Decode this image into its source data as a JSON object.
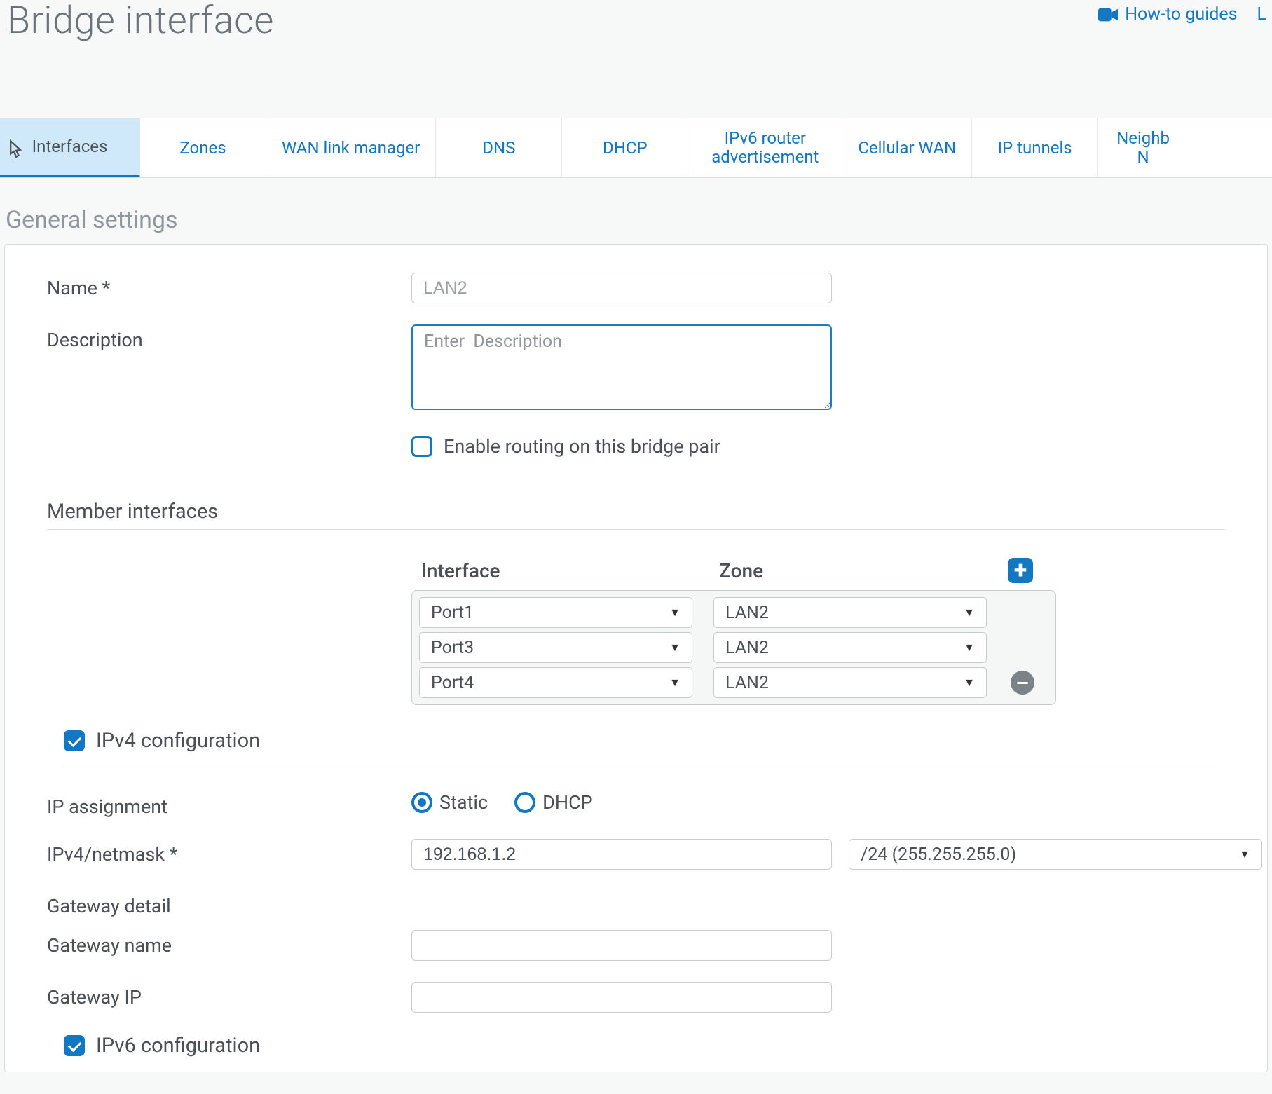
{
  "header": {
    "title": "Bridge interface",
    "howto_link": "How-to guides",
    "extra_link": "L"
  },
  "tabs": {
    "items": [
      {
        "label": "Interfaces",
        "active": true
      },
      {
        "label": "Zones"
      },
      {
        "label": "WAN link manager"
      },
      {
        "label": "DNS"
      },
      {
        "label": "DHCP"
      },
      {
        "label": "IPv6 router advertisement",
        "twoLine": true
      },
      {
        "label": "Cellular WAN"
      },
      {
        "label": "IP tunnels"
      },
      {
        "label": "Neighb\nN",
        "twoLine": true
      }
    ]
  },
  "section": {
    "general_heading": "General settings",
    "name_label": "Name *",
    "name_value": "LAN2",
    "desc_label": "Description",
    "desc_placeholder": "Enter  Description",
    "enable_routing_label": "Enable routing on this bridge pair",
    "member_heading": "Member interfaces",
    "member_cols": {
      "interface": "Interface",
      "zone": "Zone"
    },
    "member_rows": [
      {
        "interface": "Port1",
        "zone": "LAN2"
      },
      {
        "interface": "Port3",
        "zone": "LAN2"
      },
      {
        "interface": "Port4",
        "zone": "LAN2"
      }
    ],
    "ipv4_label": "IPv4 configuration",
    "ip_assignment_label": "IP assignment",
    "ip_assignment": {
      "static": "Static",
      "dhcp": "DHCP",
      "selected": "static"
    },
    "ipv4_netmask_label": "IPv4/netmask *",
    "ipv4_value": "192.168.1.2",
    "netmask_value": "/24 (255.255.255.0)",
    "gateway_detail_label": "Gateway detail",
    "gateway_name_label": "Gateway name",
    "gateway_name_value": "",
    "gateway_ip_label": "Gateway IP",
    "gateway_ip_value": "",
    "ipv6_label": "IPv6 configuration"
  }
}
